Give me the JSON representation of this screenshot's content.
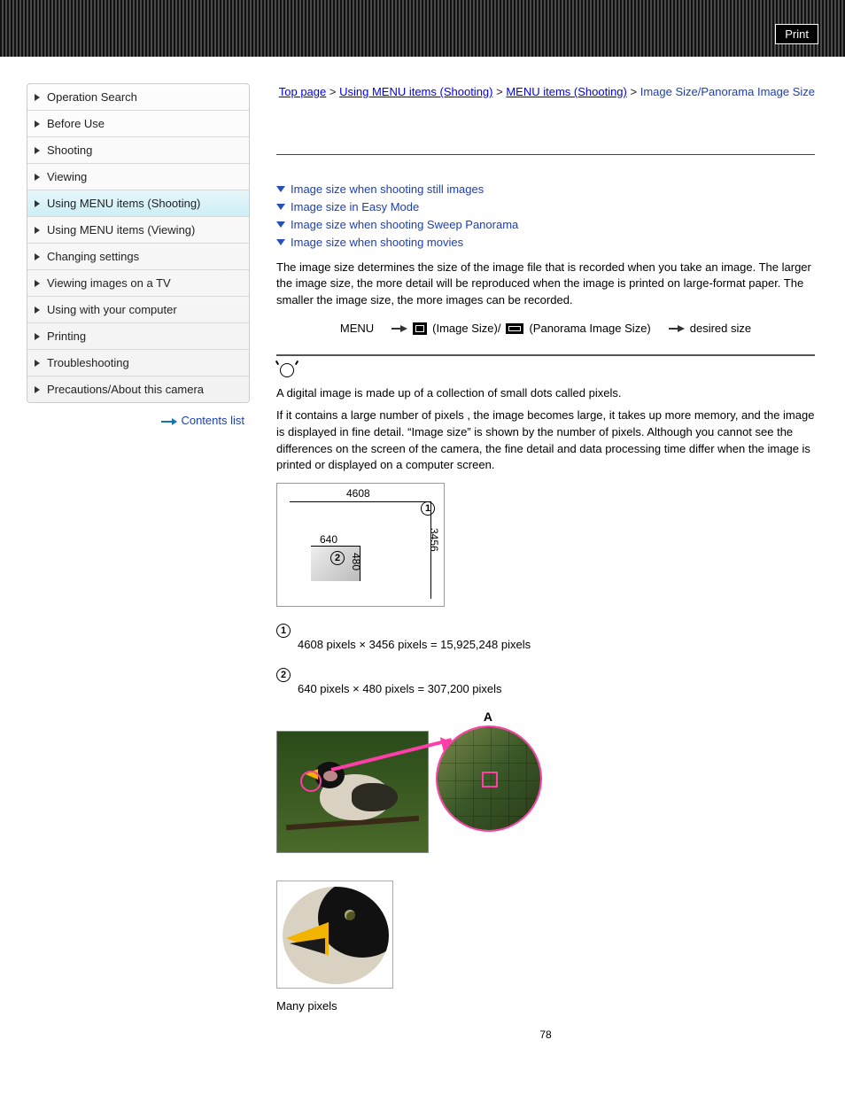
{
  "print_label": "Print",
  "sidebar": {
    "items": [
      {
        "label": "Operation Search"
      },
      {
        "label": "Before Use"
      },
      {
        "label": "Shooting"
      },
      {
        "label": "Viewing"
      },
      {
        "label": "Using MENU items (Shooting)",
        "active": true
      },
      {
        "label": "Using MENU items (Viewing)"
      },
      {
        "label": "Changing settings"
      },
      {
        "label": "Viewing images on a TV"
      },
      {
        "label": "Using with your computer"
      },
      {
        "label": "Printing"
      },
      {
        "label": "Troubleshooting"
      },
      {
        "label": "Precautions/About this camera"
      }
    ],
    "contents_list": "Contents list"
  },
  "breadcrumb": {
    "top": "Top page",
    "l1": "Using MENU items (Shooting)",
    "l2": "MENU items (Shooting)",
    "current": "Image Size/Panorama Image Size"
  },
  "anchors": [
    "Image size when shooting still images",
    "Image size in Easy Mode",
    "Image size when shooting Sweep Panorama",
    "Image size when shooting movies"
  ],
  "intro": "The image size determines the size of the image file that is recorded when you take an image. The larger the image size, the more detail will be reproduced when the image is printed on large-format paper. The smaller the image size, the more images can be recorded.",
  "menu_path": {
    "menu": "MENU",
    "img_size": "(Image Size)/",
    "pano": "(Panorama Image Size)",
    "desired": "desired size"
  },
  "tip": {
    "p1": "A digital image is made up of a collection of small dots called pixels.",
    "p2": "If it contains a large number of pixels        , the image becomes large, it takes up more memory, and the image is displayed in fine detail. “Image size” is shown by the number of pixels. Although you cannot see the differences on the screen of the camera, the fine detail and data processing time differ when the image is printed or displayed on a computer screen."
  },
  "diagram": {
    "w_big": "4608",
    "h_big": "3456",
    "w_small": "640",
    "h_small": "480"
  },
  "pixel_lines": {
    "line1": "4608 pixels × 3456 pixels = 15,925,248 pixels",
    "line2": "640 pixels × 480 pixels = 307,200 pixels"
  },
  "zoom_label": "A",
  "caption": "Many pixels",
  "page_number": "78"
}
